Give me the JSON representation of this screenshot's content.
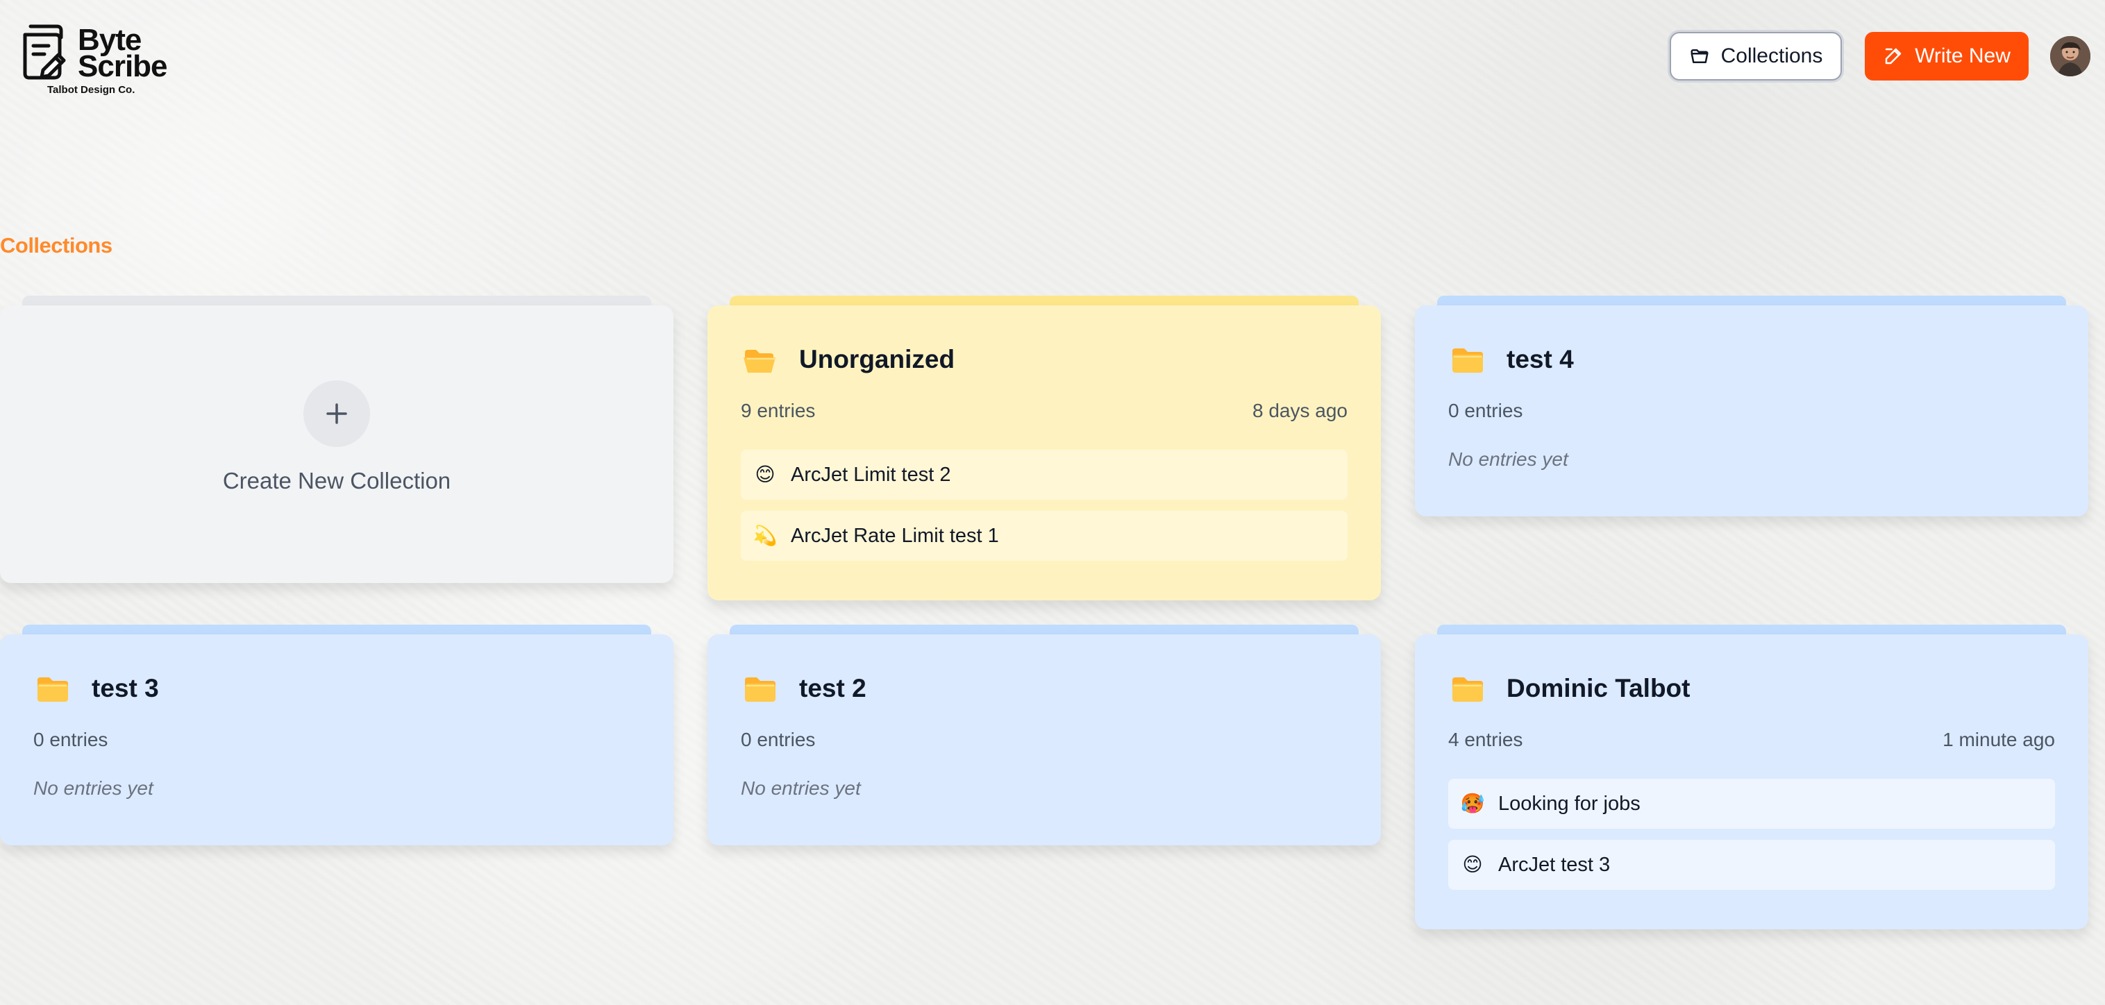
{
  "brand": {
    "line1": "Byte",
    "line2": "Scribe",
    "subtitle": "Talbot Design Co."
  },
  "header": {
    "collections_label": "Collections",
    "write_new_label": "Write New"
  },
  "page": {
    "title": "Collections"
  },
  "create_collection": {
    "label": "Create New Collection"
  },
  "collections": [
    {
      "name": "Unorganized",
      "entry_count": "9 entries",
      "updated": "8 days ago",
      "theme": "yellow",
      "folder_state": "open",
      "entries": [
        {
          "emoji": "😊",
          "title": "ArcJet Limit test 2"
        },
        {
          "emoji": "💫",
          "title": "ArcJet Rate Limit test 1"
        }
      ]
    },
    {
      "name": "test 4",
      "entry_count": "0 entries",
      "empty_text": "No entries yet",
      "theme": "blue",
      "folder_state": "closed"
    },
    {
      "name": "test 3",
      "entry_count": "0 entries",
      "empty_text": "No entries yet",
      "theme": "blue",
      "folder_state": "closed"
    },
    {
      "name": "test 2",
      "entry_count": "0 entries",
      "empty_text": "No entries yet",
      "theme": "blue",
      "folder_state": "closed"
    },
    {
      "name": "Dominic Talbot",
      "entry_count": "4 entries",
      "updated": "1 minute ago",
      "theme": "blue",
      "folder_state": "closed",
      "entries": [
        {
          "emoji": "🥵",
          "title": "Looking for jobs"
        },
        {
          "emoji": "😊",
          "title": "ArcJet test 3"
        }
      ]
    }
  ],
  "colors": {
    "accent_orange": "#ff4d08",
    "title_orange": "#ff8a2a",
    "yellow_card": "#fef3c0",
    "blue_card": "#dbeafe",
    "neutral_card": "#f2f3f5"
  },
  "icons": {
    "folder": "folder-icon",
    "folder_open": "folder-open-icon",
    "edit": "edit-icon",
    "plus": "plus-icon"
  }
}
